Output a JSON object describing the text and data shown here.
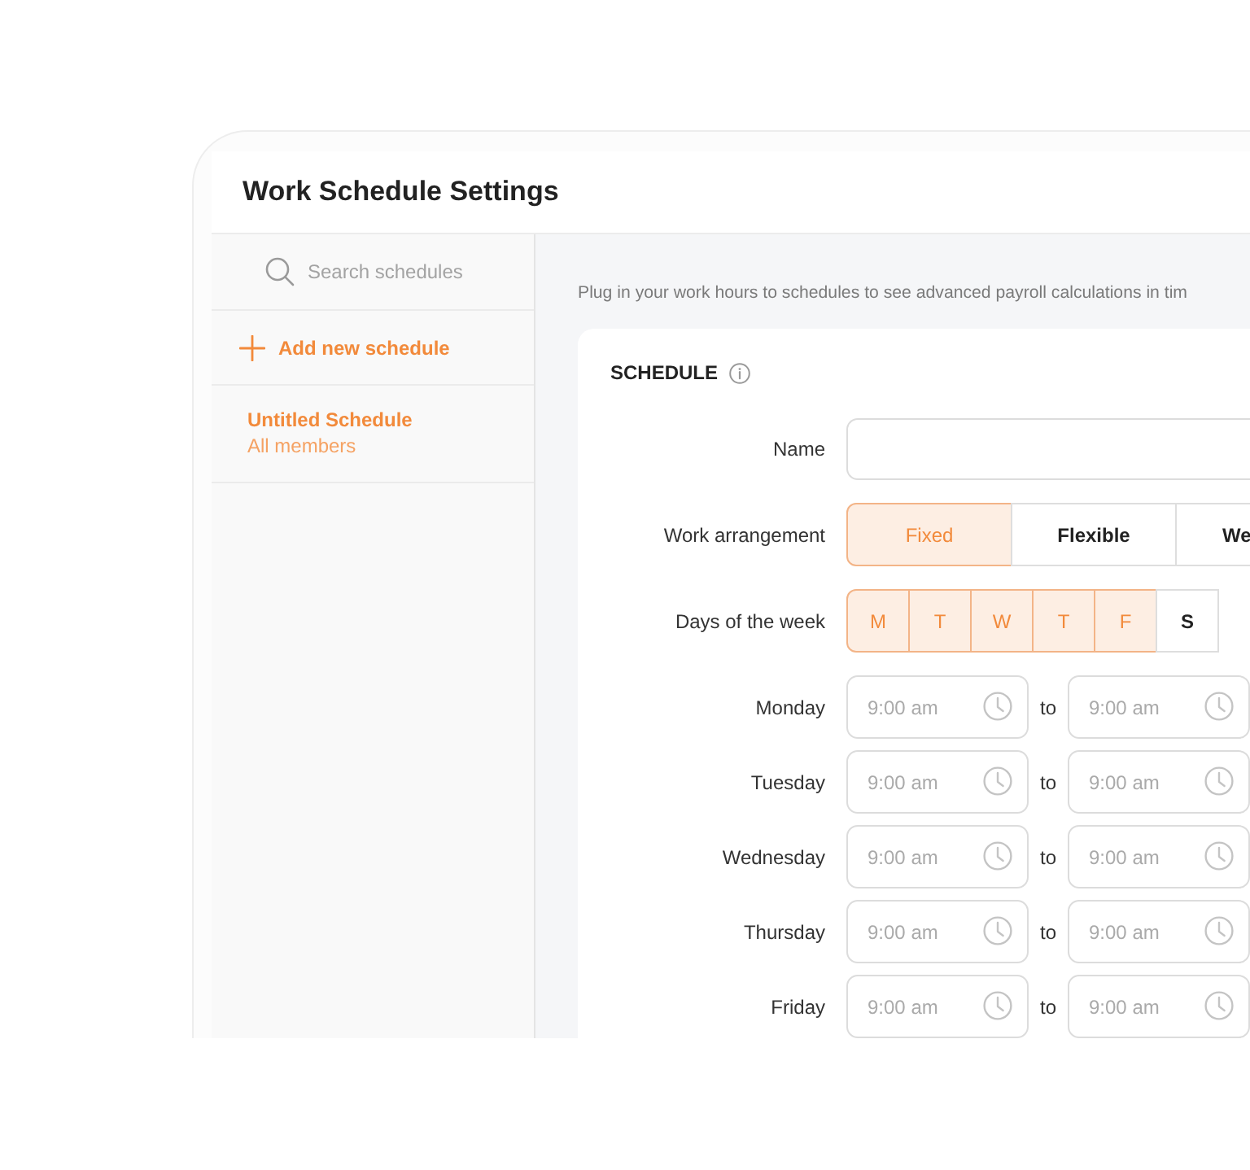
{
  "window": {
    "title": "Work Schedule Settings"
  },
  "sidebar": {
    "search": {
      "placeholder": "Search schedules"
    },
    "add_button": {
      "label": "Add new schedule"
    },
    "items": [
      {
        "title": "Untitled Schedule",
        "subtitle": "All members",
        "selected": true
      }
    ]
  },
  "main": {
    "description": "Plug in your work hours to schedules to see advanced payroll calculations in tim",
    "card": {
      "title": "SCHEDULE",
      "name_field": {
        "label": "Name"
      },
      "work_arrangement": {
        "label": "Work arrangement",
        "options": [
          {
            "label": "Fixed",
            "selected": true
          },
          {
            "label": "Flexible",
            "selected": false
          },
          {
            "label": "We",
            "selected": false
          }
        ]
      },
      "days_of_week": {
        "label": "Days of the week",
        "days": [
          {
            "label": "M",
            "selected": true
          },
          {
            "label": "T",
            "selected": true
          },
          {
            "label": "W",
            "selected": true
          },
          {
            "label": "T",
            "selected": true
          },
          {
            "label": "F",
            "selected": true
          },
          {
            "label": "S",
            "selected": false
          }
        ]
      },
      "hours": [
        {
          "day": "Monday",
          "start": {
            "placeholder": "9:00 am"
          },
          "separator": "to",
          "end": {
            "placeholder": "9:00 am"
          }
        },
        {
          "day": "Tuesday",
          "start": {
            "placeholder": "9:00 am"
          },
          "separator": "to",
          "end": {
            "placeholder": "9:00 am"
          }
        },
        {
          "day": "Wednesday",
          "start": {
            "placeholder": "9:00 am"
          },
          "separator": "to",
          "end": {
            "placeholder": "9:00 am"
          }
        },
        {
          "day": "Thursday",
          "start": {
            "placeholder": "9:00 am"
          },
          "separator": "to",
          "end": {
            "placeholder": "9:00 am"
          }
        },
        {
          "day": "Friday",
          "start": {
            "placeholder": "9:00 am"
          },
          "separator": "to",
          "end": {
            "placeholder": "9:00 am"
          }
        }
      ]
    }
  }
}
